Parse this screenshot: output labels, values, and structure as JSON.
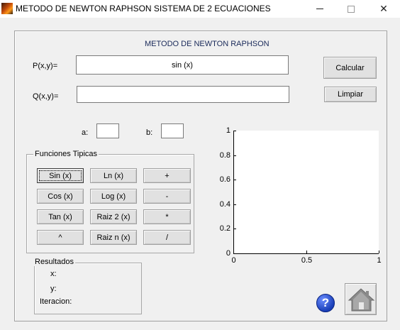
{
  "window": {
    "title": "METODO DE NEWTON RAPHSON  SISTEMA DE 2 ECUACIONES",
    "min": "—",
    "max": "□",
    "close": "✕"
  },
  "header": {
    "caption": "METODO DE NEWTON RAPHSON"
  },
  "inputs": {
    "p_label": "P(x,y)=",
    "p_value": "sin (x)",
    "q_label": "Q(x,y)=",
    "q_value": "",
    "a_label": "a:",
    "a_value": "",
    "b_label": "b:",
    "b_value": ""
  },
  "actions": {
    "calcular": "Calcular",
    "limpiar": "Limpiar"
  },
  "funciones": {
    "title": "Funciones Tipicas",
    "buttons": [
      [
        "Sin (x)",
        "Ln (x)",
        "+"
      ],
      [
        "Cos (x)",
        "Log (x)",
        "-"
      ],
      [
        "Tan (x)",
        "Raiz 2 (x)",
        "*"
      ],
      [
        "^",
        "Raiz n (x)",
        "/"
      ]
    ]
  },
  "resultados": {
    "title": "Resultados",
    "x_label": "x:",
    "y_label": "y:",
    "iter_label": "Iteracion:"
  },
  "chart_data": {
    "type": "line",
    "series": [],
    "xlim": [
      0,
      1
    ],
    "ylim": [
      0,
      1
    ],
    "xticks": [
      "0",
      "0.5",
      "1"
    ],
    "yticks": [
      "0",
      "0.2",
      "0.4",
      "0.6",
      "0.8",
      "1"
    ],
    "grid": false
  },
  "icons": {
    "help": "help-icon",
    "home": "home-icon",
    "help_glyph": "?"
  }
}
